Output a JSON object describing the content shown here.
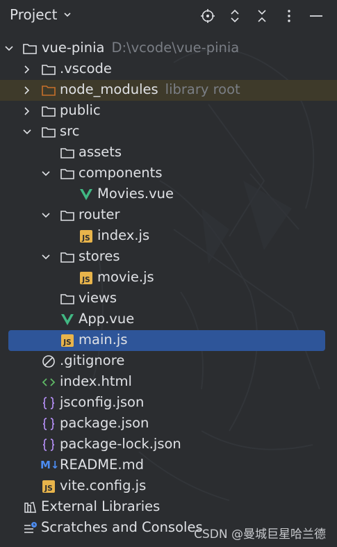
{
  "header": {
    "title": "Project",
    "icons": [
      "locate-icon",
      "expand-collapse-icon",
      "collapse-all-icon",
      "more-icon",
      "minimize-icon"
    ]
  },
  "tree": {
    "root": {
      "label": "vue-pinia",
      "path": "D:\\vcode\\vue-pinia"
    },
    "vscode": "vscode",
    "vscode_dot": ".vscode",
    "node_modules": "node_modules",
    "node_modules_hint": "library root",
    "public": "public",
    "src": "src",
    "assets": "assets",
    "components": "components",
    "movies_vue": "Movies.vue",
    "router": "router",
    "router_index": "index.js",
    "stores": "stores",
    "movie_js": "movie.js",
    "views": "views",
    "app_vue": "App.vue",
    "main_js": "main.js",
    "gitignore": ".gitignore",
    "index_html": "index.html",
    "jsconfig": "jsconfig.json",
    "package_json": "package.json",
    "package_lock": "package-lock.json",
    "readme": "README.md",
    "vite_config": "vite.config.js",
    "external_libraries": "External Libraries",
    "scratches": "Scratches and Consoles"
  },
  "badges": {
    "js": "JS",
    "md": "M↓"
  },
  "watermark": "CSDN @曼城巨星哈兰德",
  "colors": {
    "background": "#2b2d30",
    "text": "#dfe1e5",
    "hint": "#7a7e85",
    "selected": "#2e5599",
    "library_root_bg": "#3e3a2a",
    "node_modules_folder": "#c7702a",
    "vue_green": "#41b883",
    "js_yellow": "#e8b44b",
    "json_purple": "#b18cf0",
    "html_green": "#5fb865",
    "md_blue": "#4c8cf0"
  }
}
